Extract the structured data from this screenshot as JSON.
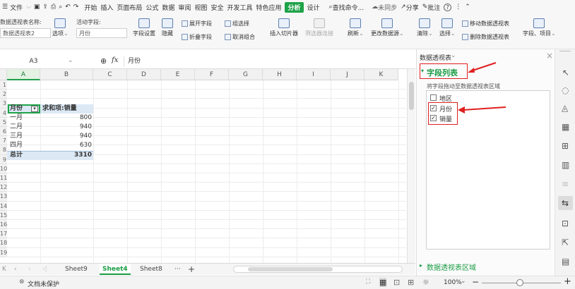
{
  "menubar": {
    "items": [
      "文件",
      "开始",
      "插入",
      "页面布局",
      "公式",
      "数据",
      "审阅",
      "视图",
      "安全",
      "开发工具",
      "特色应用",
      "分析",
      "设计"
    ],
    "active": "分析",
    "search": "查找命令...",
    "sync": "未同步",
    "share": "分享",
    "comment": "批注",
    "help": "?"
  },
  "ribbon": {
    "pivot_name_label": "数据透视表名称:",
    "pivot_name_value": "数据透视表2",
    "options": "选项",
    "active_field_label": "活动字段:",
    "active_field_value": "月份",
    "field_settings": "字段设置",
    "hide": "隐藏",
    "expand_field": "展开字段",
    "collapse_field": "折叠字段",
    "group_select": "组选择",
    "ungroup": "取消组合",
    "insert_slicer": "插入切片器",
    "filter_connection": "筛选器连接",
    "refresh": "刷新",
    "change_source": "更改数据源",
    "clear": "清除",
    "select": "选择",
    "move_pivot": "移动数据透视表",
    "delete_pivot": "删除数据透视表",
    "fields_items": "字段、项目"
  },
  "formula_bar": {
    "cell_ref": "A3",
    "fx": "fx",
    "content": "月份"
  },
  "grid": {
    "columns": [
      "A",
      "B",
      "C",
      "D",
      "E",
      "F",
      "G",
      "H",
      "I",
      "J",
      "K"
    ],
    "rows": [
      "1",
      "2",
      "3",
      "4",
      "5",
      "6",
      "7",
      "8",
      "9",
      "10",
      "11",
      "12",
      "13",
      "14",
      "15",
      "16",
      "17",
      "18",
      "19"
    ],
    "header": {
      "a": "月份",
      "b": "求和项:销量"
    },
    "data": [
      {
        "a": "一月",
        "b": "800"
      },
      {
        "a": "二月",
        "b": "940"
      },
      {
        "a": "三月",
        "b": "940"
      },
      {
        "a": "四月",
        "b": "630"
      }
    ],
    "total": {
      "a": "总计",
      "b": "3310"
    }
  },
  "sheet_tabs": [
    "Sheet9",
    "Sheet4",
    "Sheet8"
  ],
  "active_sheet": "Sheet4",
  "tab_more": "···",
  "tab_add": "+",
  "status": {
    "protect": "文档未保护",
    "zoom": "100%"
  },
  "panel": {
    "title": "数据透视表",
    "field_list": "字段列表",
    "hint": "将字段拖动至数据透视表区域",
    "fields": [
      {
        "name": "地区",
        "checked": false
      },
      {
        "name": "月份",
        "checked": true
      },
      {
        "name": "销量",
        "checked": true
      }
    ],
    "areas": "数据透视表区域",
    "close": "×"
  },
  "colors": {
    "accent": "#1fa349",
    "annotation": "#e02020",
    "pivot_header": "#dce9f5"
  }
}
